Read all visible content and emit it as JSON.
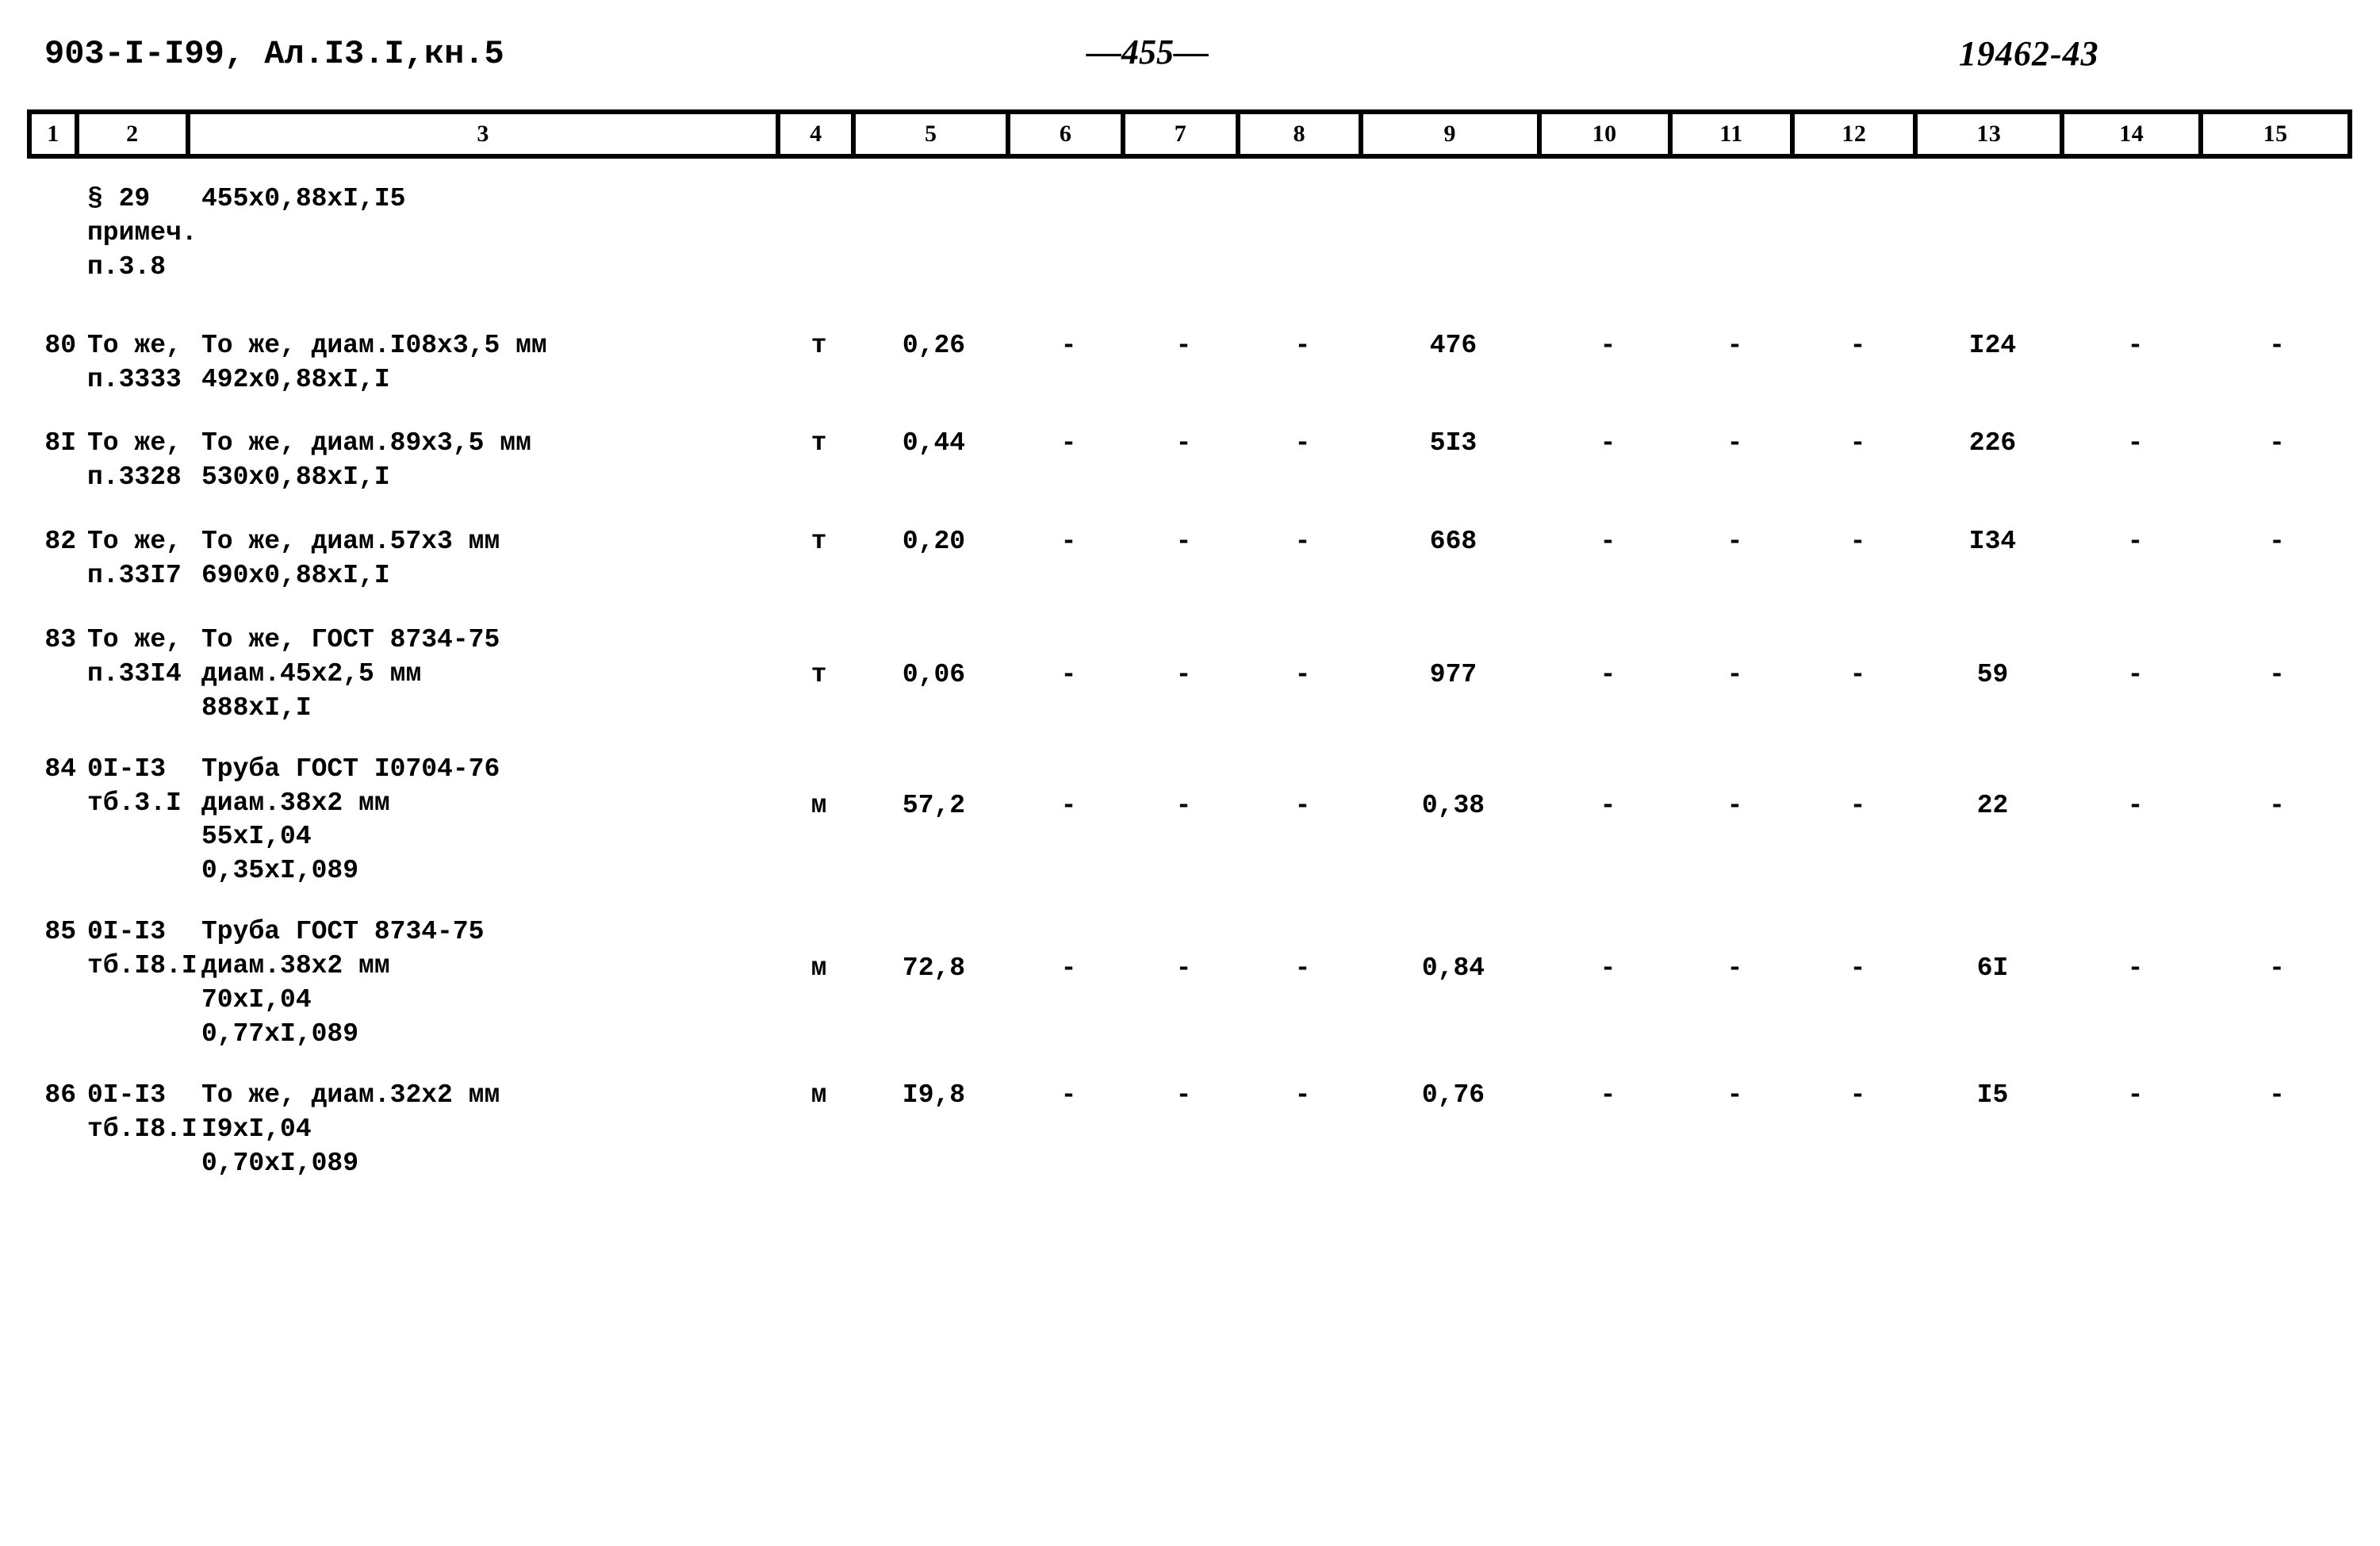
{
  "header": {
    "doc_code": "903-I-I99, Ал.I3.I,кн.5",
    "page_number": "—455—",
    "sheet_number": "19462-43"
  },
  "column_numbers": [
    "1",
    "2",
    "3",
    "4",
    "5",
    "6",
    "7",
    "8",
    "9",
    "10",
    "11",
    "12",
    "13",
    "14",
    "15"
  ],
  "dash": "-",
  "rows": [
    {
      "c1": "",
      "c2": "§ 29\nпримеч.\nп.3.8",
      "c3": "455x0,88xI,I5",
      "c4": "",
      "c5": "",
      "c6": "",
      "c7": "",
      "c8": "",
      "c9": "",
      "c10": "",
      "c11": "",
      "c12": "",
      "c13": "",
      "c14": "",
      "c15": ""
    },
    {
      "c1": "80",
      "c2": "То же,\n  п.3333",
      "c3": "То же, диам.I08x3,5 мм\n492x0,88xI,I",
      "c4": "т",
      "c5": "0,26",
      "c6": "-",
      "c7": "-",
      "c8": "-",
      "c9": "476",
      "c10": "-",
      "c11": "-",
      "c12": "-",
      "c13": "I24",
      "c14": "-",
      "c15": "-"
    },
    {
      "c1": "8I",
      "c2": "То же,\n  п.3328",
      "c3": "То же, диам.89x3,5 мм\n530x0,88xI,I",
      "c4": "т",
      "c5": "0,44",
      "c6": "-",
      "c7": "-",
      "c8": "-",
      "c9": "5I3",
      "c10": "-",
      "c11": "-",
      "c12": "-",
      "c13": "226",
      "c14": "-",
      "c15": "-"
    },
    {
      "c1": "82",
      "c2": "То же,\n  п.33I7",
      "c3": "То же, диам.57x3 мм\n690x0,88xI,I",
      "c4": "т",
      "c5": "0,20",
      "c6": "-",
      "c7": "-",
      "c8": "-",
      "c9": "668",
      "c10": "-",
      "c11": "-",
      "c12": "-",
      "c13": "I34",
      "c14": "-",
      "c15": "-"
    },
    {
      "c1": "83",
      "c2": "То же,\n  п.33I4",
      "c3": "То же, ГОСТ 8734-75\nдиам.45x2,5 мм\n888xI,I",
      "c4": "т",
      "c5": "0,06",
      "c6": "-",
      "c7": "-",
      "c8": "-",
      "c9": "977",
      "c10": "-",
      "c11": "-",
      "c12": "-",
      "c13": "59",
      "c14": "-",
      "c15": "-"
    },
    {
      "c1": "84",
      "c2": "0I-I3\n  тб.3.I",
      "c3": "Труба ГОСТ I0704-76\nдиам.38x2 мм\n55xI,04\n0,35xI,089",
      "c4": "м",
      "c5": "57,2",
      "c6": "-",
      "c7": "-",
      "c8": "-",
      "c9": "0,38",
      "c10": "-",
      "c11": "-",
      "c12": "-",
      "c13": "22",
      "c14": "-",
      "c15": "-"
    },
    {
      "c1": "85",
      "c2": "0I-I3\n  тб.I8.I",
      "c3": "Труба ГОСТ 8734-75\nдиам.38x2 мм\n70xI,04\n0,77xI,089",
      "c4": "м",
      "c5": "72,8",
      "c6": "-",
      "c7": "-",
      "c8": "-",
      "c9": "0,84",
      "c10": "-",
      "c11": "-",
      "c12": "-",
      "c13": "6I",
      "c14": "-",
      "c15": "-"
    },
    {
      "c1": "86",
      "c2": "0I-I3\n  тб.I8.I",
      "c3": "То же, диам.32x2 мм\nI9xI,04\n0,70xI,089",
      "c4": "м",
      "c5": "I9,8",
      "c6": "-",
      "c7": "-",
      "c8": "-",
      "c9": "0,76",
      "c10": "-",
      "c11": "-",
      "c12": "-",
      "c13": "I5",
      "c14": "-",
      "c15": "-"
    }
  ]
}
